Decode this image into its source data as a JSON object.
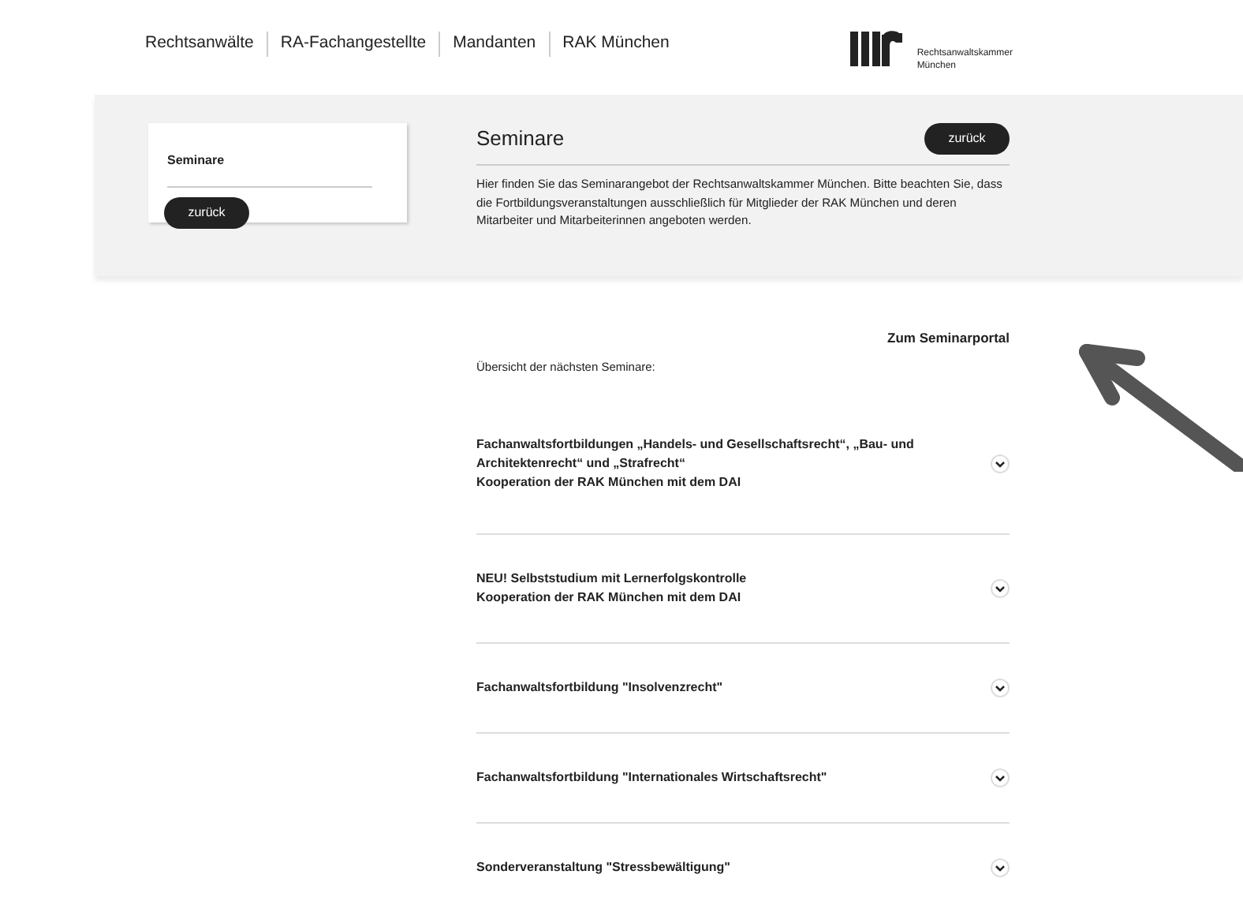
{
  "nav": [
    "Rechtsanwälte",
    "RA-Fachangestellte",
    "Mandanten",
    "RAK München"
  ],
  "logo": {
    "lines": [
      "Rechtsanwaltskammer",
      "München"
    ]
  },
  "sidebar": {
    "title": "Seminare",
    "button": "zurück"
  },
  "header": {
    "title": "Seminare",
    "button": "zurück",
    "text": "Hier finden Sie das Seminarangebot der Rechtsanwaltskammer München. Bitte beachten Sie, dass die Fortbildungsveranstaltungen ausschließlich für Mitglieder der RAK München und deren Mitarbeiter und Mitarbeiterinnen angeboten werden."
  },
  "portal_link": "Zum Seminarportal",
  "overview": "Übersicht der nächsten Seminare:",
  "items": [
    {
      "lines": [
        "Fachanwaltsfortbildungen „Handels- und Gesellschaftsrecht“, „Bau- und Architektenrecht“ und „Strafrecht“",
        "Kooperation der RAK München mit dem DAI"
      ],
      "expanded": false
    },
    {
      "lines": [
        "NEU! Selbststudium mit Lernerfolgskontrolle",
        "Kooperation der RAK München mit dem DAI"
      ],
      "expanded": false
    },
    {
      "lines": [
        "Fachanwaltsfortbildung \"Insolvenzrecht\""
      ],
      "expanded": false
    },
    {
      "lines": [
        "Fachanwaltsfortbildung \"Internationales Wirtschaftsrecht\""
      ],
      "expanded": false
    },
    {
      "lines": [
        "Sonderveranstaltung \"Stressbewältigung\""
      ],
      "expanded": false
    }
  ]
}
